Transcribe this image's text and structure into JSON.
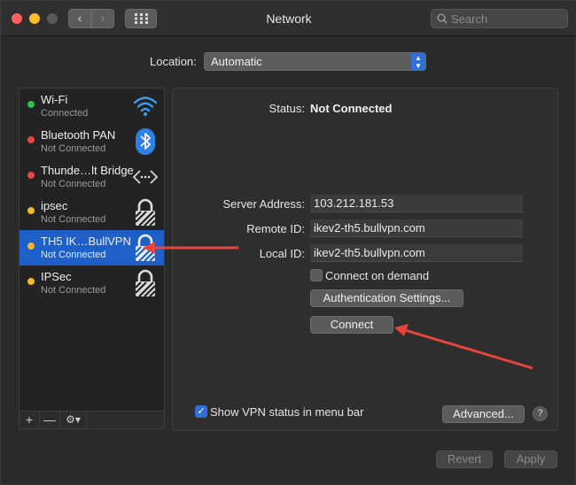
{
  "window": {
    "title": "Network"
  },
  "search": {
    "placeholder": "Search"
  },
  "location": {
    "label": "Location:",
    "value": "Automatic"
  },
  "services": [
    {
      "name": "Wi-Fi",
      "status": "Connected",
      "dot_color": "#2fc04a",
      "icon": "wifi-icon"
    },
    {
      "name": "Bluetooth PAN",
      "status": "Not Connected",
      "dot_color": "#e8453c",
      "icon": "bluetooth-icon"
    },
    {
      "name": "Thunde…lt Bridge",
      "status": "Not Connected",
      "dot_color": "#e8453c",
      "icon": "thunderbolt-bridge-icon"
    },
    {
      "name": "ipsec",
      "status": "Not Connected",
      "dot_color": "#f5b52f",
      "icon": "lock-icon"
    },
    {
      "name": "TH5 IK…BullVPN",
      "status": "Not Connected",
      "dot_color": "#f5b52f",
      "icon": "lock-icon",
      "selected": true
    },
    {
      "name": "IPSec",
      "status": "Not Connected",
      "dot_color": "#f5b52f",
      "icon": "lock-icon"
    }
  ],
  "sidebar_toolbar": {
    "add": "+",
    "remove": "—"
  },
  "detail": {
    "status_label": "Status:",
    "status_value": "Not Connected",
    "server_label": "Server Address:",
    "server_value": "103.212.181.53",
    "remote_label": "Remote ID:",
    "remote_value": "ikev2-th5.bullvpn.com",
    "local_label": "Local ID:",
    "local_value": "ikev2-th5.bullvpn.com",
    "connect_on_demand_label": "Connect on demand",
    "connect_on_demand_checked": false,
    "auth_button": "Authentication Settings...",
    "connect_button": "Connect",
    "show_vpn_label": "Show VPN status in menu bar",
    "show_vpn_checked": true,
    "advanced_button": "Advanced...",
    "help": "?"
  },
  "footer": {
    "revert": "Revert",
    "apply": "Apply"
  },
  "colors": {
    "accent": "#2f6fd6",
    "selection": "#1f5fc8",
    "annotation_arrow": "#e5453c"
  }
}
